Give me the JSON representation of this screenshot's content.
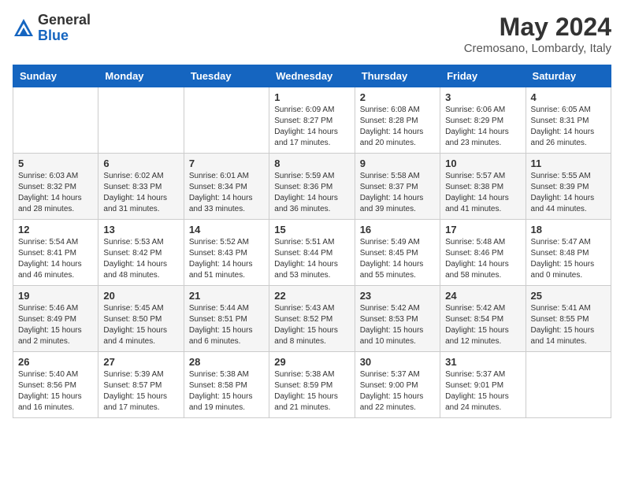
{
  "header": {
    "logo_general": "General",
    "logo_blue": "Blue",
    "month_year": "May 2024",
    "location": "Cremosano, Lombardy, Italy"
  },
  "days_of_week": [
    "Sunday",
    "Monday",
    "Tuesday",
    "Wednesday",
    "Thursday",
    "Friday",
    "Saturday"
  ],
  "weeks": [
    [
      {
        "day": "",
        "info": ""
      },
      {
        "day": "",
        "info": ""
      },
      {
        "day": "",
        "info": ""
      },
      {
        "day": "1",
        "info": "Sunrise: 6:09 AM\nSunset: 8:27 PM\nDaylight: 14 hours\nand 17 minutes."
      },
      {
        "day": "2",
        "info": "Sunrise: 6:08 AM\nSunset: 8:28 PM\nDaylight: 14 hours\nand 20 minutes."
      },
      {
        "day": "3",
        "info": "Sunrise: 6:06 AM\nSunset: 8:29 PM\nDaylight: 14 hours\nand 23 minutes."
      },
      {
        "day": "4",
        "info": "Sunrise: 6:05 AM\nSunset: 8:31 PM\nDaylight: 14 hours\nand 26 minutes."
      }
    ],
    [
      {
        "day": "5",
        "info": "Sunrise: 6:03 AM\nSunset: 8:32 PM\nDaylight: 14 hours\nand 28 minutes."
      },
      {
        "day": "6",
        "info": "Sunrise: 6:02 AM\nSunset: 8:33 PM\nDaylight: 14 hours\nand 31 minutes."
      },
      {
        "day": "7",
        "info": "Sunrise: 6:01 AM\nSunset: 8:34 PM\nDaylight: 14 hours\nand 33 minutes."
      },
      {
        "day": "8",
        "info": "Sunrise: 5:59 AM\nSunset: 8:36 PM\nDaylight: 14 hours\nand 36 minutes."
      },
      {
        "day": "9",
        "info": "Sunrise: 5:58 AM\nSunset: 8:37 PM\nDaylight: 14 hours\nand 39 minutes."
      },
      {
        "day": "10",
        "info": "Sunrise: 5:57 AM\nSunset: 8:38 PM\nDaylight: 14 hours\nand 41 minutes."
      },
      {
        "day": "11",
        "info": "Sunrise: 5:55 AM\nSunset: 8:39 PM\nDaylight: 14 hours\nand 44 minutes."
      }
    ],
    [
      {
        "day": "12",
        "info": "Sunrise: 5:54 AM\nSunset: 8:41 PM\nDaylight: 14 hours\nand 46 minutes."
      },
      {
        "day": "13",
        "info": "Sunrise: 5:53 AM\nSunset: 8:42 PM\nDaylight: 14 hours\nand 48 minutes."
      },
      {
        "day": "14",
        "info": "Sunrise: 5:52 AM\nSunset: 8:43 PM\nDaylight: 14 hours\nand 51 minutes."
      },
      {
        "day": "15",
        "info": "Sunrise: 5:51 AM\nSunset: 8:44 PM\nDaylight: 14 hours\nand 53 minutes."
      },
      {
        "day": "16",
        "info": "Sunrise: 5:49 AM\nSunset: 8:45 PM\nDaylight: 14 hours\nand 55 minutes."
      },
      {
        "day": "17",
        "info": "Sunrise: 5:48 AM\nSunset: 8:46 PM\nDaylight: 14 hours\nand 58 minutes."
      },
      {
        "day": "18",
        "info": "Sunrise: 5:47 AM\nSunset: 8:48 PM\nDaylight: 15 hours\nand 0 minutes."
      }
    ],
    [
      {
        "day": "19",
        "info": "Sunrise: 5:46 AM\nSunset: 8:49 PM\nDaylight: 15 hours\nand 2 minutes."
      },
      {
        "day": "20",
        "info": "Sunrise: 5:45 AM\nSunset: 8:50 PM\nDaylight: 15 hours\nand 4 minutes."
      },
      {
        "day": "21",
        "info": "Sunrise: 5:44 AM\nSunset: 8:51 PM\nDaylight: 15 hours\nand 6 minutes."
      },
      {
        "day": "22",
        "info": "Sunrise: 5:43 AM\nSunset: 8:52 PM\nDaylight: 15 hours\nand 8 minutes."
      },
      {
        "day": "23",
        "info": "Sunrise: 5:42 AM\nSunset: 8:53 PM\nDaylight: 15 hours\nand 10 minutes."
      },
      {
        "day": "24",
        "info": "Sunrise: 5:42 AM\nSunset: 8:54 PM\nDaylight: 15 hours\nand 12 minutes."
      },
      {
        "day": "25",
        "info": "Sunrise: 5:41 AM\nSunset: 8:55 PM\nDaylight: 15 hours\nand 14 minutes."
      }
    ],
    [
      {
        "day": "26",
        "info": "Sunrise: 5:40 AM\nSunset: 8:56 PM\nDaylight: 15 hours\nand 16 minutes."
      },
      {
        "day": "27",
        "info": "Sunrise: 5:39 AM\nSunset: 8:57 PM\nDaylight: 15 hours\nand 17 minutes."
      },
      {
        "day": "28",
        "info": "Sunrise: 5:38 AM\nSunset: 8:58 PM\nDaylight: 15 hours\nand 19 minutes."
      },
      {
        "day": "29",
        "info": "Sunrise: 5:38 AM\nSunset: 8:59 PM\nDaylight: 15 hours\nand 21 minutes."
      },
      {
        "day": "30",
        "info": "Sunrise: 5:37 AM\nSunset: 9:00 PM\nDaylight: 15 hours\nand 22 minutes."
      },
      {
        "day": "31",
        "info": "Sunrise: 5:37 AM\nSunset: 9:01 PM\nDaylight: 15 hours\nand 24 minutes."
      },
      {
        "day": "",
        "info": ""
      }
    ]
  ]
}
